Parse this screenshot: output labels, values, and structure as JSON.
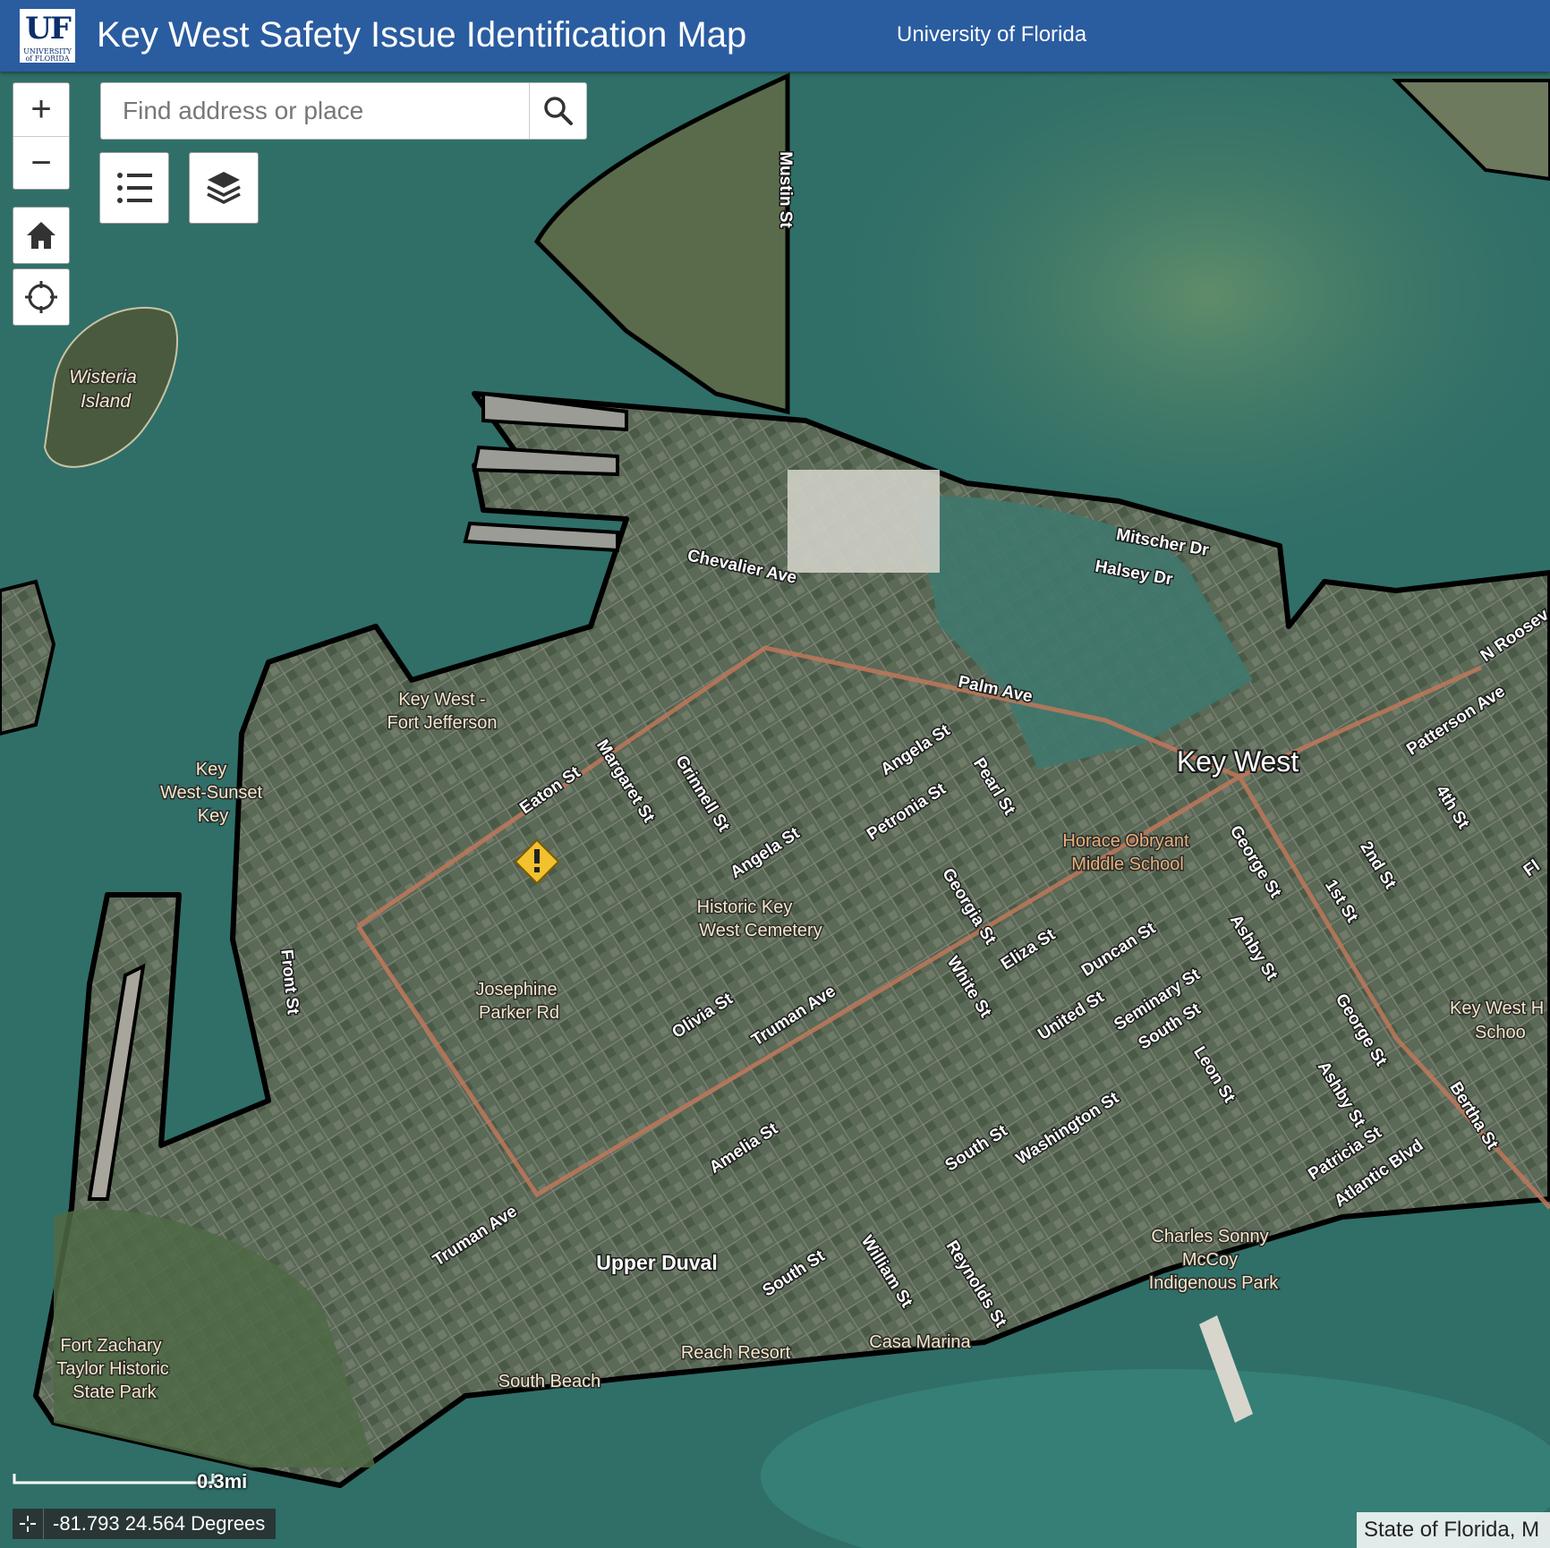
{
  "header": {
    "logo_text": "UF",
    "logo_subtext": "UNIVERSITY of FLORIDA",
    "title": "Key West Safety Issue Identification Map",
    "organization": "University of Florida"
  },
  "controls": {
    "zoom_in_label": "+",
    "zoom_out_label": "−",
    "home_icon": "home-icon",
    "locate_icon": "locate-icon",
    "legend_icon": "legend-list-icon",
    "layers_icon": "layers-icon"
  },
  "search": {
    "placeholder": "Find address or place",
    "value": ""
  },
  "map": {
    "place_labels": {
      "wisteria_island": [
        "Wisteria",
        "Island"
      ],
      "key_west_city": "Key West",
      "key_west_fort_jefferson": [
        "Key West -",
        "Fort Jefferson"
      ],
      "key_west_sunset_key": [
        "Key",
        "West-Sunset",
        "Key"
      ],
      "horace_obryant": [
        "Horace Obryant",
        "Middle School"
      ],
      "historic_cemetery": [
        "Historic Key",
        "West Cemetery"
      ],
      "josephine_parker": [
        "Josephine",
        "Parker Rd"
      ],
      "key_west_school": [
        "Key West H",
        "Schoo"
      ],
      "upper_duval": "Upper Duval",
      "charles_sonny_mccoy": [
        "Charles Sonny",
        "McCoy",
        "Indigenous Park"
      ],
      "fort_zachary": [
        "Fort Zachary",
        "Taylor Historic",
        "State Park"
      ],
      "reach_resort": "Reach Resort",
      "casa_marina": "Casa Marina",
      "south_beach": "South Beach"
    },
    "street_labels": {
      "mustin": "Mustin St",
      "mitscher": "Mitscher Dr",
      "halsey": "Halsey Dr",
      "chevalier": "Chevalier Ave",
      "palm": "Palm Ave",
      "n_roosevelt": "N Roosev",
      "patterson": "Patterson Ave",
      "fourth": "4th St",
      "second": "2nd St",
      "first": "1st St",
      "fl_cut": "Fl",
      "eaton": "Eaton St",
      "margaret": "Margaret St",
      "grinnell": "Grinnell St",
      "angela_1": "Angela St",
      "angela_2": "Angela St",
      "petronia": "Petronia St",
      "pearl": "Pearl St",
      "george_1": "George St",
      "george_2": "George St",
      "ashby_1": "Ashby St",
      "ashby_2": "Ashby St",
      "georgia": "Georgia St",
      "white": "White St",
      "eliza": "Eliza St",
      "duncan": "Duncan St",
      "united": "United St",
      "seminary": "Seminary St",
      "south_1": "South St",
      "south_2": "South St",
      "south_3": "South St",
      "leon": "Leon St",
      "bertha": "Bertha St",
      "front": "Front St",
      "olivia": "Olivia St",
      "truman_1": "Truman Ave",
      "truman_2": "Truman Ave",
      "amelia": "Amelia St",
      "washington": "Washington St",
      "patricia": "Patricia St",
      "atlantic": "Atlantic Blvd",
      "william": "William St",
      "reynolds": "Reynolds St"
    },
    "issue_marker_icon": "warning-diamond-icon",
    "scale_label": "0.3mi",
    "coordinates": "-81.793 24.564 Degrees",
    "attribution": "State of Florida, M"
  },
  "colors": {
    "header_bg": "#2a5ca0",
    "boundary": "#000000",
    "route": "#c0785a",
    "marker": "#f2c12e",
    "water": "#2f6f68",
    "land": "#5c6a58"
  }
}
